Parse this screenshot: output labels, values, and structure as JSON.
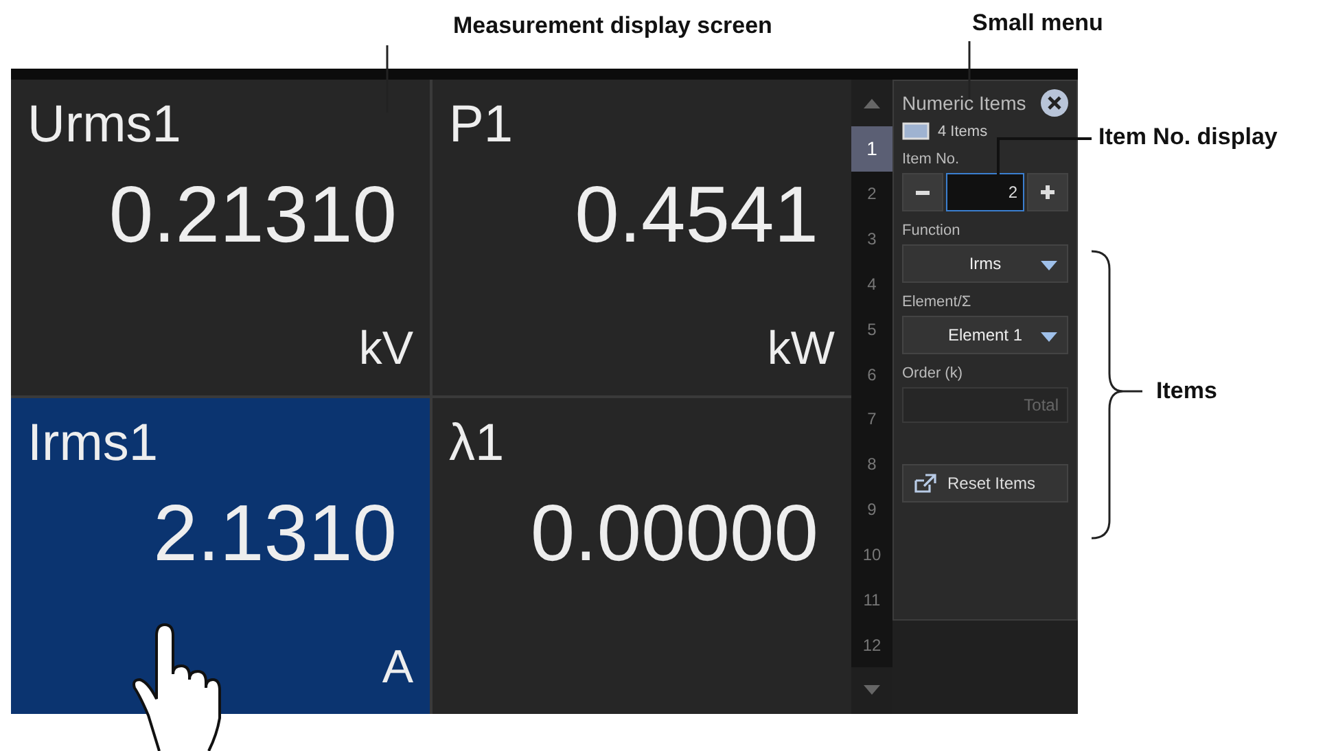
{
  "callouts": [
    {
      "kind": "top",
      "text": "Measurement display screen"
    },
    {
      "kind": "top",
      "text": "Small menu"
    },
    {
      "kind": "side",
      "text": "Item No. display"
    },
    {
      "kind": "bracket",
      "text": "Items"
    }
  ],
  "cells": [
    {
      "name": "Urms1",
      "value": "0.21310",
      "unit": "kV",
      "selected": false
    },
    {
      "name": "P1",
      "value": "0.4541",
      "unit": "kW",
      "selected": false
    },
    {
      "name": "Irms1",
      "value": "2.1310",
      "unit": "A",
      "selected": true
    },
    {
      "name": "λ1",
      "value": "0.00000",
      "selected": false
    }
  ],
  "pages": [
    {
      "label": "1",
      "selected": true
    },
    {
      "label": "2",
      "selected": false
    },
    {
      "label": "3",
      "selected": false
    },
    {
      "label": "4",
      "selected": false
    },
    {
      "label": "5",
      "selected": false
    },
    {
      "label": "6",
      "selected": false
    },
    {
      "label": "7",
      "selected": false
    },
    {
      "label": "8",
      "selected": false
    },
    {
      "label": "9",
      "selected": false
    },
    {
      "label": "10",
      "selected": false
    },
    {
      "label": "11",
      "selected": false
    },
    {
      "label": "12",
      "selected": false
    }
  ],
  "menu": {
    "title": "Numeric Items",
    "layout": "4 Items",
    "item_no": {
      "label": "Item No.",
      "value": "2"
    },
    "function": {
      "label": "Function",
      "value": "Irms"
    },
    "element": {
      "label": "Element/Σ",
      "value": "Element 1"
    },
    "order": {
      "label": "Order (k)",
      "value": "Total",
      "disabled": true
    },
    "reset_button": "Reset Items"
  }
}
